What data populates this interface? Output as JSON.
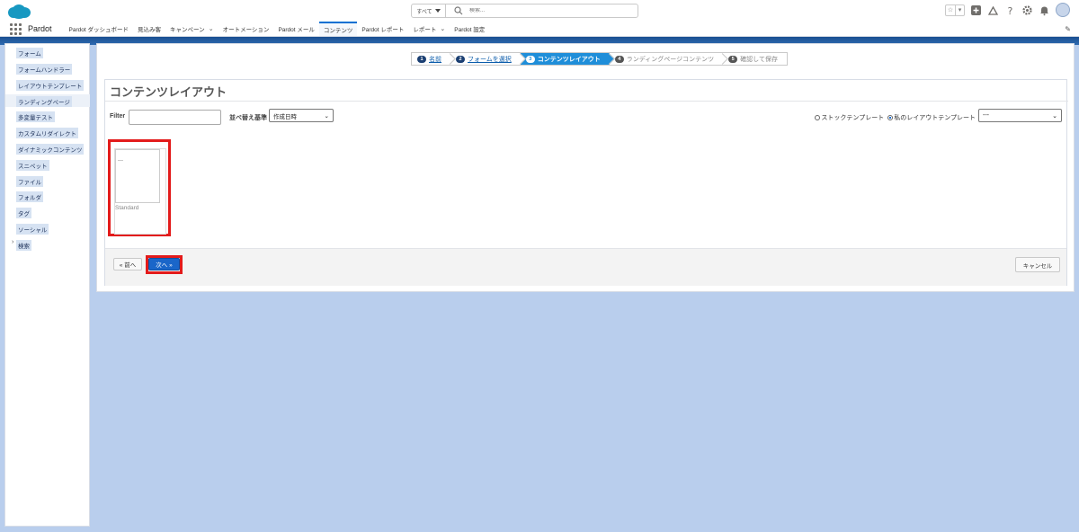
{
  "header": {
    "app_name": "Pardot",
    "search": {
      "scope": "すべて",
      "placeholder": "検索..."
    },
    "icons": [
      "salesforce-logo",
      "grid-icon",
      "search-icon",
      "star-icon",
      "plus-icon",
      "bell-icon",
      "question-icon",
      "gear-icon",
      "avatar"
    ]
  },
  "nav": {
    "items": [
      {
        "label": "Pardot ダッシュボード",
        "dropdown": false
      },
      {
        "label": "見込み客",
        "dropdown": false
      },
      {
        "label": "キャンペーン",
        "dropdown": true
      },
      {
        "label": "オートメーション",
        "dropdown": false
      },
      {
        "label": "Pardot メール",
        "dropdown": false
      },
      {
        "label": "コンテンツ",
        "dropdown": false,
        "active": true
      },
      {
        "label": "Pardot レポート",
        "dropdown": false
      },
      {
        "label": "レポート",
        "dropdown": true
      },
      {
        "label": "Pardot 設定",
        "dropdown": false
      }
    ]
  },
  "sidebar": {
    "items": [
      {
        "label": "フォーム"
      },
      {
        "label": "フォームハンドラー"
      },
      {
        "label": "レイアウトテンプレート"
      },
      {
        "label": "ランディングページ",
        "active": true
      },
      {
        "label": "多変量テスト"
      },
      {
        "label": "カスタムリダイレクト"
      },
      {
        "label": "ダイナミックコンテンツ"
      },
      {
        "label": "スニペット"
      },
      {
        "label": "ファイル"
      },
      {
        "label": "フォルダ"
      },
      {
        "label": "タグ"
      },
      {
        "label": "ソーシャル"
      },
      {
        "label": "検索",
        "expandable": true
      }
    ]
  },
  "wizard": {
    "steps": [
      {
        "num": "1",
        "label": "名前",
        "state": "done"
      },
      {
        "num": "2",
        "label": "フォームを選択",
        "state": "done"
      },
      {
        "num": "3",
        "label": "コンテンツレイアウト",
        "state": "current"
      },
      {
        "num": "4",
        "label": "ランディングページコンテンツ",
        "state": "future"
      },
      {
        "num": "5",
        "label": "確認して保存",
        "state": "future"
      }
    ]
  },
  "panel": {
    "title": "コンテンツレイアウト",
    "filter_label": "Filter",
    "filter_value": "",
    "sort_label": "並べ替え基準",
    "sort_value": "作成日時",
    "radio_stock": "ストックテンプレート",
    "radio_mine": "私のレイアウトテンプレート",
    "radio_selected": "mine",
    "layout_select_value": "---",
    "card": {
      "thumb_text": "---",
      "name": "Standard"
    },
    "prev_label": "« 前へ",
    "next_label": "次へ »",
    "cancel_label": "キャンセル"
  },
  "colors": {
    "accent": "#1a66c9",
    "highlight": "#e31b1b",
    "background": "#b9ceed"
  }
}
